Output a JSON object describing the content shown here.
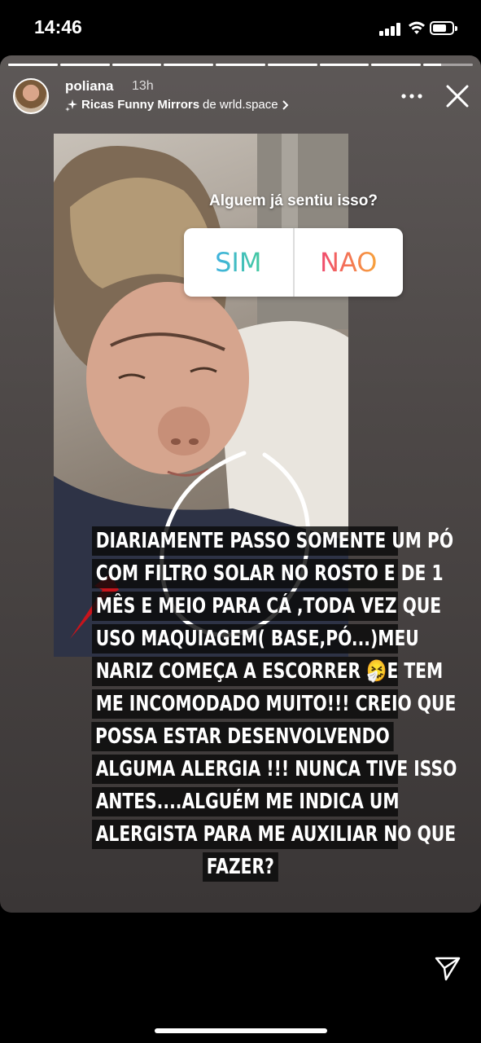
{
  "status_bar": {
    "time": "14:46"
  },
  "story": {
    "progress_segments": 9,
    "progress_current_index": 8,
    "username": "poliana",
    "age": "13h",
    "filter_name": "Ricas Funny Mirrors",
    "filter_by": "de wrld.space",
    "filter_icon": "sparkles-icon",
    "poll": {
      "question": "Alguem já sentiu isso?",
      "option_yes": "SIM",
      "option_no": "NAO"
    },
    "caption_lines": [
      "DIARIAMENTE PASSO SOMENTE UM PÓ",
      "COM FILTRO SOLAR NO ROSTO E DE 1",
      "MÊS E MEIO PARA CÁ ,TODA VEZ QUE",
      "USO MAQUIAGEM( BASE,PÓ...)MEU",
      "NARIZ COMEÇA A ESCORRER 🤧E TEM",
      "ME INCOMODADO MUITO!!! CREIO QUE",
      "POSSA ESTAR DESENVOLVENDO",
      "ALGUMA ALERGIA !!!  NUNCA TIVE ISSO",
      "ANTES....ALGUÉM ME INDICA UM",
      "ALERGISTA PARA ME AUXILIAR NO QUE",
      "FAZER?"
    ]
  },
  "colors": {
    "background": "#000000",
    "arrow": "#c8141c",
    "poll_yes": "#3fb2e0",
    "poll_no": "#f0496f"
  }
}
